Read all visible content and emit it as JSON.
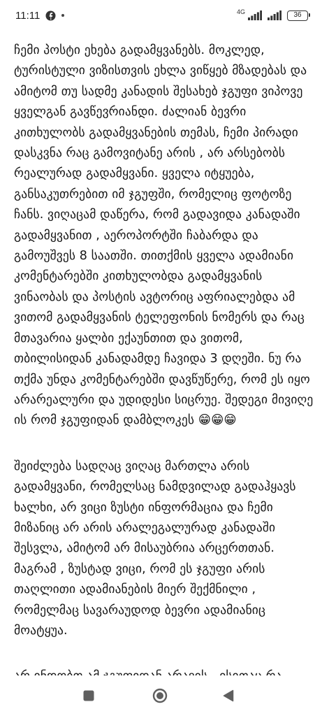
{
  "status_bar": {
    "time": "11:11",
    "network_label": "4G",
    "battery_level": "36"
  },
  "post": {
    "paragraphs": [
      "ჩემი პოსტი ეხება გადამყვანებს.  მოკლედ, ტურისტული ვიზისთვის ეხლა ვიწყებ მზადებას და ამიტომ თუ სადმე კანადის შესახებ ჯგუფი ვიპოვე ყველგან გავწევრიანდი. ძალიან ბევრი კითხულობს გადამყვანების თემას, ჩემი პირადი დასკვნა რაც გამოვიტანე არის , არ არსებობს რეალურად გადამყვანი. ყველა იტყუება, განსაკუთრებით იმ ჯგუფში, რომელიც ფოტოზე ჩანს. ვიღაცამ დაწერა, რომ გადავიდა კანადაში გადამყვანით , აეროპორტში ჩაბარდა და გამოუშვეს 8 საათში. თითქმის ყველა ადამიანი კომენტარებში კითხულობდა გადამყვანის ვინაობას და პოსტის ავტორიც აფრიალებდა ამ ვითომ გადამყვანის ტელეფონის ნომერს და რაც მთავარია ყალბი ექაუნთით და ვითომ, თბილისიდან კანადამდე ჩავიდა 3 დღეში. ნუ რა თქმა უნდა კომენტარებში დავწუწერე,  რომ ეს იყო არარეალური და უდიდესი სიცრუე. შედეგი მივიღე ის რომ ჯგუფიდან დამბლოკეს 😁😁😁",
      "შეიძლება სადღაც ვიღაც მართლა არის გადამყვანი, რომელსაც ნამდვილად გადაჰყავს ხალხი, არ ვიცი ზუსტი ინფორმაცია და ჩემი მიზანიც არ არის არალეგალურად კანადაში შესვლა, ამიტომ არ მისაუბრია არცერთთან. მაგრამ , ზუსტად ვიცი, რომ ეს ჯგუფი არის თაღლითი ადამიანების მიერ შექმნილი , რომელმაც სავარაუდოდ ბევრი ადამიანიც მოატყუა.",
      "არ ინდობთ ამ ჯგუფიდან არავის , ისითაც რა"
    ]
  },
  "nav_bar": {
    "buttons": [
      "recents",
      "home",
      "back"
    ]
  }
}
